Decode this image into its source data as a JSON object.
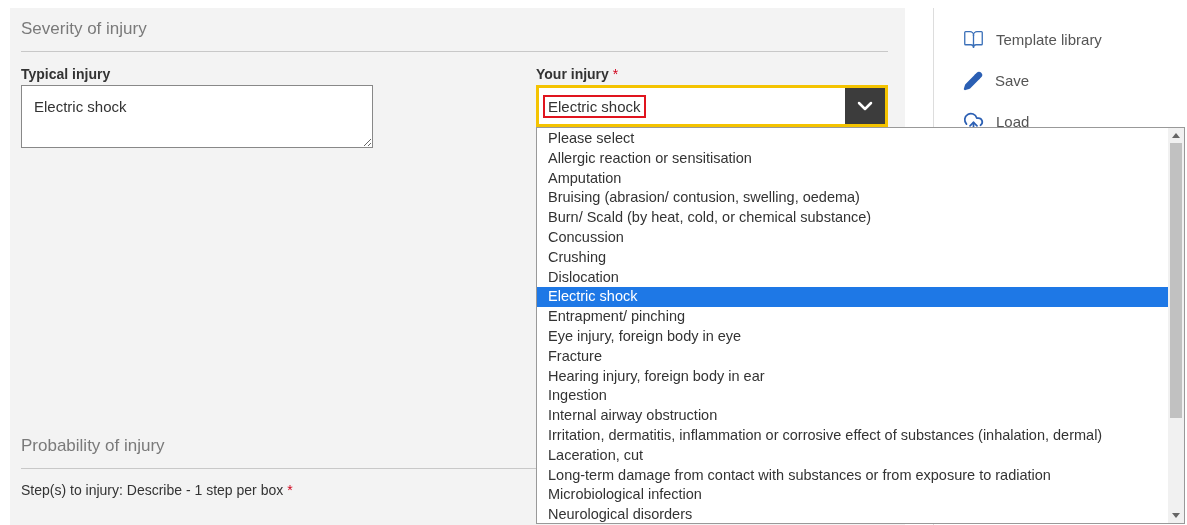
{
  "severity": {
    "heading": "Severity of injury",
    "typical_label": "Typical injury",
    "typical_value": "Electric shock",
    "your_label": "Your injury",
    "your_required": "*",
    "your_value": "Electric shock",
    "options": [
      {
        "label": "Please select",
        "selected": false
      },
      {
        "label": "Allergic reaction or sensitisation",
        "selected": false
      },
      {
        "label": "Amputation",
        "selected": false
      },
      {
        "label": "Bruising (abrasion/ contusion, swelling, oedema)",
        "selected": false
      },
      {
        "label": "Burn/ Scald (by heat, cold, or chemical substance)",
        "selected": false
      },
      {
        "label": "Concussion",
        "selected": false
      },
      {
        "label": "Crushing",
        "selected": false
      },
      {
        "label": "Dislocation",
        "selected": false
      },
      {
        "label": "Electric shock",
        "selected": true
      },
      {
        "label": "Entrapment/ pinching",
        "selected": false
      },
      {
        "label": "Eye injury, foreign body in eye",
        "selected": false
      },
      {
        "label": "Fracture",
        "selected": false
      },
      {
        "label": "Hearing injury, foreign body in ear",
        "selected": false
      },
      {
        "label": "Ingestion",
        "selected": false
      },
      {
        "label": "Internal airway obstruction",
        "selected": false
      },
      {
        "label": "Irritation, dermatitis, inflammation or corrosive effect of substances (inhalation, dermal)",
        "selected": false
      },
      {
        "label": "Laceration, cut",
        "selected": false
      },
      {
        "label": "Long-term damage from contact with substances or from exposure to radiation",
        "selected": false
      },
      {
        "label": "Microbiological infection",
        "selected": false
      },
      {
        "label": "Neurological disorders",
        "selected": false
      }
    ]
  },
  "probability": {
    "heading": "Probability of injury",
    "steps_label": "Step(s) to injury: Describe - 1 step per box",
    "steps_required": "*"
  },
  "sidebar": {
    "items": [
      {
        "kind": "book",
        "label": "Template library"
      },
      {
        "kind": "pencil",
        "label": "Save"
      },
      {
        "kind": "upload",
        "label": "Load"
      }
    ]
  }
}
